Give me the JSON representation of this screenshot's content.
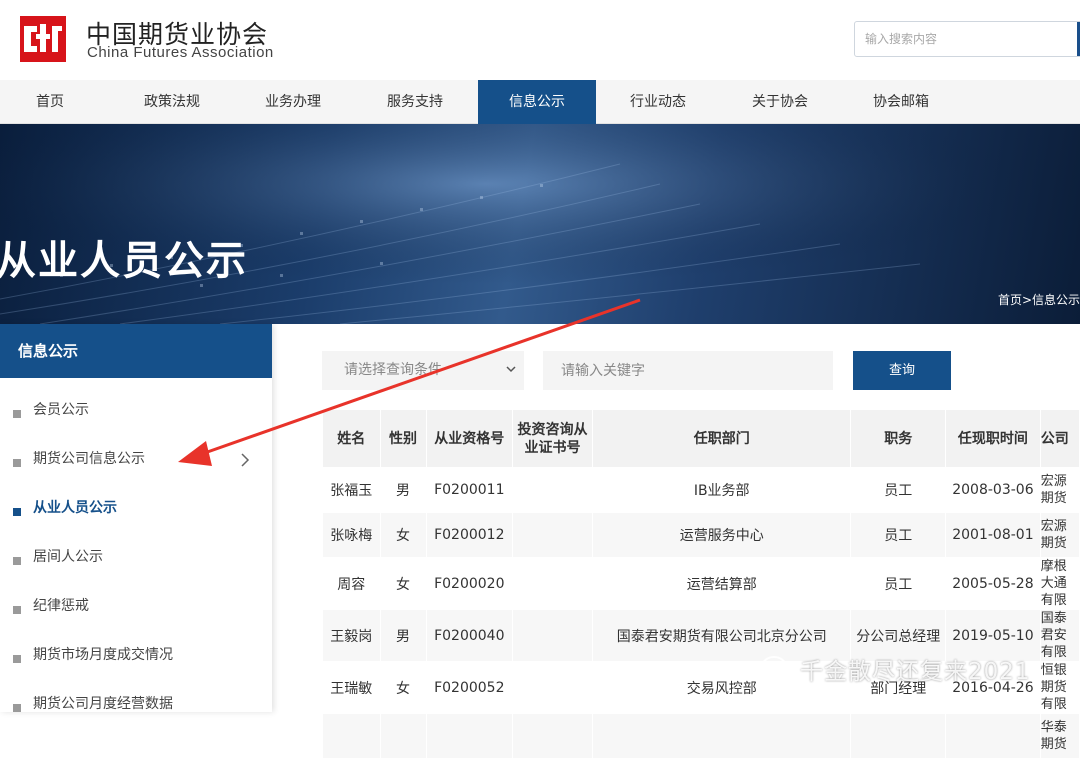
{
  "header": {
    "logo_cn": "中国期货业协会",
    "logo_en": "China Futures Association",
    "search_placeholder": "输入搜索内容"
  },
  "nav": {
    "items": [
      {
        "label": "首页"
      },
      {
        "label": "政策法规"
      },
      {
        "label": "业务办理"
      },
      {
        "label": "服务支持"
      },
      {
        "label": "信息公示",
        "active": true
      },
      {
        "label": "行业动态"
      },
      {
        "label": "关于协会"
      },
      {
        "label": "协会邮箱"
      }
    ]
  },
  "banner": {
    "title": "从业人员公示",
    "breadcrumb": "首页>信息公示"
  },
  "sidebar": {
    "heading": "信息公示",
    "items": [
      {
        "label": "会员公示"
      },
      {
        "label": "期货公司信息公示"
      },
      {
        "label": "从业人员公示",
        "active": true
      },
      {
        "label": "居间人公示"
      },
      {
        "label": "纪律惩戒"
      },
      {
        "label": "期货市场月度成交情况"
      },
      {
        "label": "期货公司月度经营数据"
      }
    ]
  },
  "filter": {
    "select_label": "请选择查询条件",
    "keyword_placeholder": "请输入关键字",
    "query_label": "查询"
  },
  "table": {
    "headers": [
      "姓名",
      "性别",
      "从业资格号",
      "投资咨询从业证书号",
      "任职部门",
      "职务",
      "任现职时间",
      "公司"
    ],
    "rows": [
      [
        "张福玉",
        "男",
        "F0200011",
        "",
        "IB业务部",
        "员工",
        "2008-03-06",
        "宏源期货"
      ],
      [
        "张咏梅",
        "女",
        "F0200012",
        "",
        "运营服务中心",
        "员工",
        "2001-08-01",
        "宏源期货"
      ],
      [
        "周容",
        "女",
        "F0200020",
        "",
        "运营结算部",
        "员工",
        "2005-05-28",
        "摩根大通有限"
      ],
      [
        "王毅岗",
        "男",
        "F0200040",
        "",
        "国泰君安期货有限公司北京分公司",
        "分公司总经理",
        "2019-05-10",
        "国泰君安有限"
      ],
      [
        "王瑞敏",
        "女",
        "F0200052",
        "",
        "交易风控部",
        "部门经理",
        "2016-04-26",
        "恒银期货有限"
      ],
      [
        "",
        "",
        "",
        "",
        "",
        "",
        "",
        "华泰期货"
      ]
    ]
  },
  "watermark": {
    "text": "千金散尽还复来2021"
  }
}
